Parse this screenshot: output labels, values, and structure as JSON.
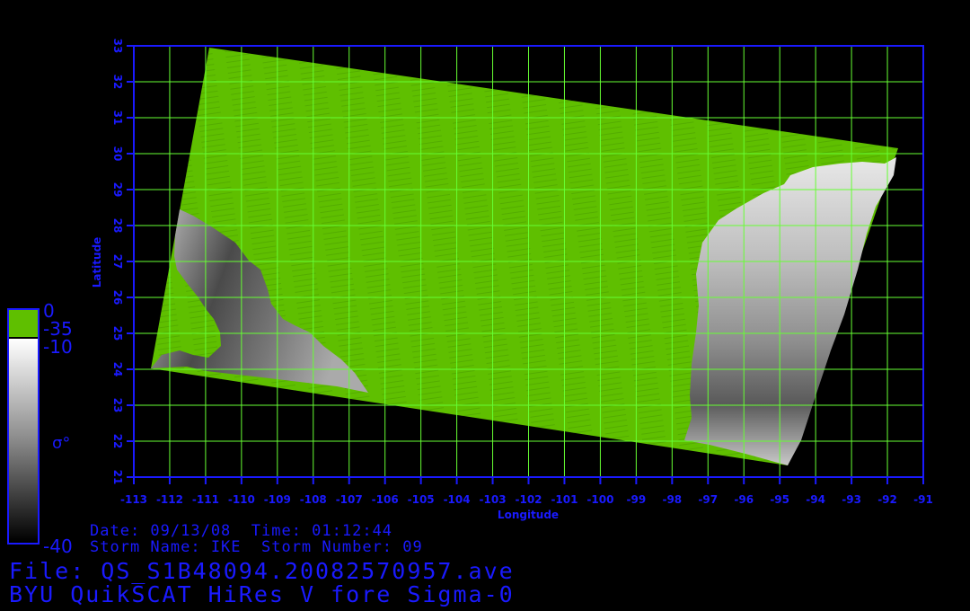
{
  "map": {
    "x_ticks": [
      "-113",
      "-112",
      "-111",
      "-110",
      "-109",
      "-108",
      "-107",
      "-106",
      "-105",
      "-104",
      "-103",
      "-102",
      "-101",
      "-100",
      "-99",
      "-98",
      "-97",
      "-96",
      "-95",
      "-94",
      "-93",
      "-92",
      "-91"
    ],
    "y_ticks": [
      "21",
      "22",
      "23",
      "24",
      "25",
      "26",
      "27",
      "28",
      "29",
      "30",
      "31",
      "32",
      "33"
    ],
    "xlabel": "Longitude",
    "ylabel": "Latitude",
    "lon_range": [
      -113,
      -91
    ],
    "lat_range": [
      21,
      33
    ],
    "colors": {
      "axis": "#1a1aff",
      "grid": "#66ff33",
      "ocean": "#5fbf00",
      "background": "#000000"
    }
  },
  "colorbar": {
    "top_label": "0",
    "green_label": "-35",
    "gray_top_label": "-10",
    "bottom_label": "-40",
    "symbol": "σ°"
  },
  "info": {
    "date_line": "Date: 09/13/08  Time: 01:12:44",
    "storm_line": "Storm Name: IKE  Storm Number: 09",
    "file_line": "File: QS_S1B48094.20082570957.ave",
    "product_line": "BYU QuikSCAT HiRes V fore Sigma-0"
  }
}
